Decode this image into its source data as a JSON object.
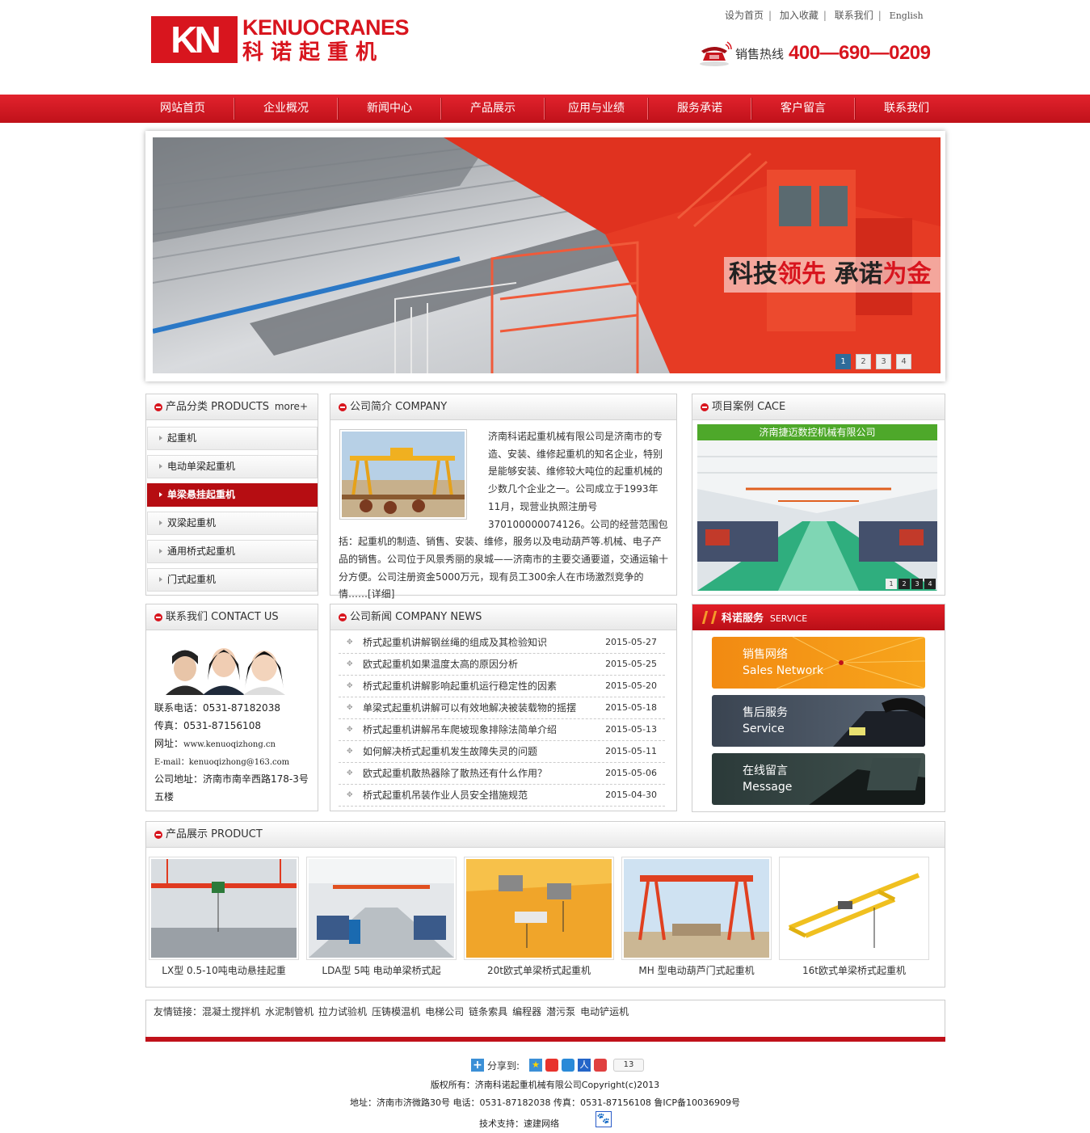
{
  "header": {
    "logo_mark": "KN",
    "logo_en": "KENUOCRANES",
    "logo_cn": "科诺起重机",
    "top_links": [
      "设为首页",
      "加入收藏",
      "联系我们",
      "English"
    ],
    "hotline_label": "销售热线",
    "hotline_number": "400—690—0209"
  },
  "nav": [
    "网站首页",
    "企业概况",
    "新闻中心",
    "产品展示",
    "应用与业绩",
    "服务承诺",
    "客户留言",
    "联系我们"
  ],
  "banner": {
    "slogan": {
      "a": "科技",
      "b": "领先",
      "c": "承诺",
      "d": "为金"
    },
    "dots": [
      "1",
      "2",
      "3",
      "4"
    ],
    "active_dot": "1"
  },
  "products_panel": {
    "title": "产品分类 PRODUCTS",
    "more": "more+",
    "items": [
      "起重机",
      "电动单梁起重机",
      "单梁悬挂起重机",
      "双梁起重机",
      "通用桥式起重机",
      "门式起重机"
    ],
    "active": "单梁悬挂起重机"
  },
  "intro_panel": {
    "title": "公司简介 COMPANY",
    "text": "济南科诺起重机械有限公司是济南市的专造、安装、维修起重机的知名企业，特别是能够安装、维修较大吨位的起重机械的少数几个企业之一。公司成立于1993年11月，现营业执照注册号370100000074126。公司的经营范围包括：起重机的制造、销售、安装、维修，服务以及电动葫芦等.机械、电子产 品的销售。公司位于风景秀丽的泉城——济南市的主要交通要道，交通运输十 分方便。公司注册资金5000万元，现有员工300余人在市场激烈竞争的情……",
    "detail_link": "[详细]"
  },
  "cases_panel": {
    "title": "项目案例 CACE",
    "caption": "济南捷迈数控机械有限公司",
    "dots": [
      "1",
      "2",
      "3",
      "4"
    ]
  },
  "contact_panel": {
    "title": "联系我们 CONTACT US",
    "phone_label": "联系电话：",
    "phone": "0531-87182038",
    "fax_label": "传真：",
    "fax": "0531-87156108",
    "web_label": "网址：",
    "web": "www.kenuoqizhong.cn",
    "email_label": "E-mail：",
    "email": "kenuoqizhong@163.com",
    "addr_label": "公司地址：",
    "addr": "济南市南辛西路178-3号五楼"
  },
  "news_panel": {
    "title": "公司新闻 COMPANY NEWS",
    "items": [
      {
        "t": "桥式起重机讲解钢丝绳的组成及其检验知识",
        "d": "2015-05-27"
      },
      {
        "t": "欧式起重机如果温度太高的原因分析",
        "d": "2015-05-25"
      },
      {
        "t": "桥式起重机讲解影响起重机运行稳定性的因素",
        "d": "2015-05-20"
      },
      {
        "t": "单梁式起重机讲解可以有效地解决被装载物的摇摆",
        "d": "2015-05-18"
      },
      {
        "t": "桥式起重机讲解吊车爬坡现象排除法简单介绍",
        "d": "2015-05-13"
      },
      {
        "t": "如何解决桥式起重机发生故障失灵的问题",
        "d": "2015-05-11"
      },
      {
        "t": "欧式起重机散热器除了散热还有什么作用？",
        "d": "2015-05-06"
      },
      {
        "t": "桥式起重机吊装作业人员安全措施规范",
        "d": "2015-04-30"
      }
    ]
  },
  "service_panel": {
    "title_cn": "科诺服务",
    "title_en": "SERVICE",
    "items": [
      {
        "cn": "销售网络",
        "en": "Sales Network",
        "color": "#f08c10"
      },
      {
        "cn": "售后服务",
        "en": "Service",
        "color": "#3b4654"
      },
      {
        "cn": "在线留言",
        "en": "Message",
        "color": "#2c3b3a"
      }
    ]
  },
  "product_panel": {
    "title": "产品展示 PRODUCT",
    "items": [
      "LX型 0.5-10吨电动悬挂起重",
      "LDA型 5吨 电动单梁桥式起",
      "20t欧式单梁桥式起重机",
      "MH 型电动葫芦门式起重机",
      "16t欧式单梁桥式起重机"
    ]
  },
  "links": {
    "label": "友情链接：",
    "items": [
      "混凝土搅拌机",
      "水泥制管机",
      "拉力试验机",
      "压铸模温机",
      "电梯公司",
      "链条索具",
      "编程器",
      "潜污泵",
      "电动铲运机"
    ]
  },
  "footer": {
    "share_label": "分享到:",
    "share_count": "13",
    "copyright": "版权所有：济南科诺起重机械有限公司Copyright(c)2013",
    "address": "地址：济南市济微路30号 电话：0531-87182038 传真：0531-87156108 鲁ICP备10036909号",
    "support": "技术支持：速建网络"
  },
  "colors": {
    "brand_red": "#d8151e",
    "nav_red": "#c0111a",
    "case_green": "#4ea82a"
  }
}
